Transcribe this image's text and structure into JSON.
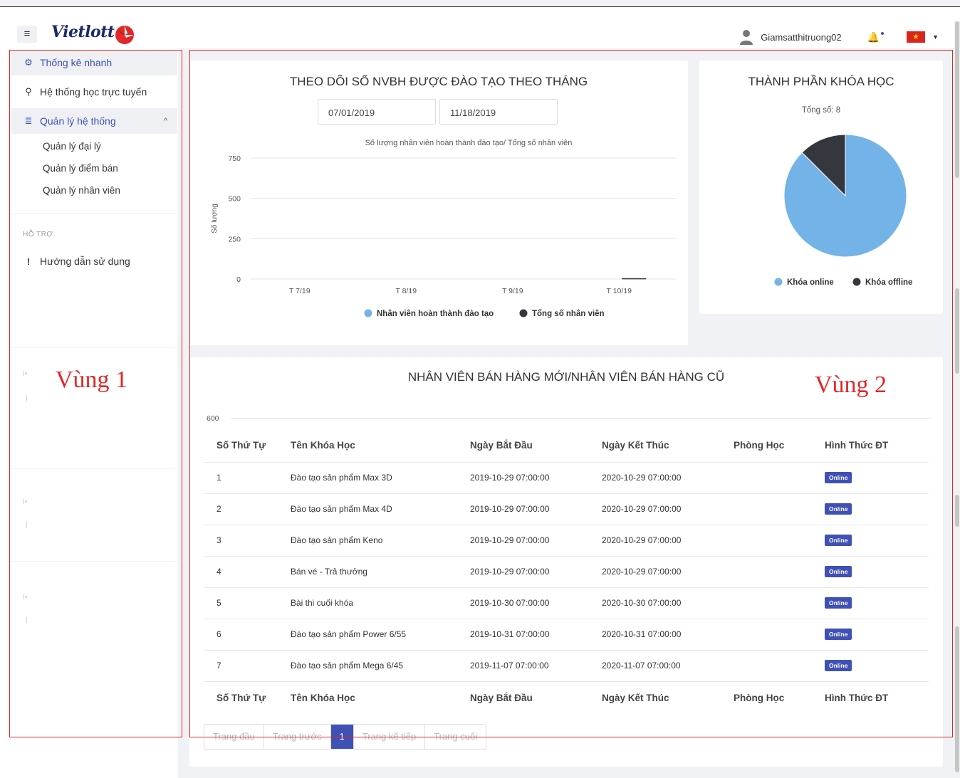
{
  "header": {
    "menu_icon": "hamburger-icon",
    "logo_text": "Vietlott",
    "username": "Giamsatthitruong02",
    "notification_icon": "bell-icon",
    "language_icon": "vietnam-flag-icon",
    "flag_star": "★",
    "menu_glyph": "≡",
    "caret": "▼"
  },
  "sidebar": {
    "items": [
      {
        "label": "Thống kê nhanh",
        "icon": "dashboard-icon",
        "glyph": "⚙"
      },
      {
        "label": "Hệ thống học trực tuyến",
        "icon": "graduation-cap-icon",
        "glyph": "🎓"
      },
      {
        "label": "Quản lý hệ thống",
        "icon": "database-icon",
        "glyph": "≣",
        "expand": "^"
      }
    ],
    "subitems": [
      "Quản lý đại lý",
      "Quản lý điểm bán",
      "Quản lý nhân viên"
    ],
    "section_caption": "HỖ TRỢ",
    "help_item": {
      "label": "Hướng dẫn sử dụng",
      "icon": "exclamation-icon",
      "glyph": "!"
    },
    "faint_mark": "I•",
    "faint_sub": "|"
  },
  "annotations": {
    "zone1": "Vùng 1",
    "zone2": "Vùng 2"
  },
  "training_card": {
    "title": "THEO DÕI SỐ NVBH ĐƯỢC ĐÀO TẠO THEO THÁNG",
    "date_from": "07/01/2019",
    "date_to": "11/18/2019"
  },
  "pie_card": {
    "title": "THÀNH PHẦN KHÓA HỌC",
    "total": "Tổng số: 8"
  },
  "chart_data": [
    {
      "type": "bar",
      "title": "Số lượng nhân viên hoàn thành đào tạo/ Tổng số nhân viên",
      "xlabel": "",
      "ylabel": "Số lượng",
      "categories": [
        "T 7/19",
        "T 8/19",
        "T 9/19",
        "T 10/19"
      ],
      "yticks": [
        "0",
        "250",
        "500",
        "750"
      ],
      "ylim": [
        0,
        750
      ],
      "series": [
        {
          "name": "Nhân viên hoàn thành đào tạo",
          "values": [
            0,
            0,
            0,
            0
          ],
          "color": "#74b3e8"
        },
        {
          "name": "Tổng số nhân viên",
          "values": [
            0,
            0,
            0,
            5
          ],
          "color": "#34373d"
        }
      ],
      "legend": "bottom"
    },
    {
      "type": "pie",
      "title": "",
      "labels": [
        "Khóa online",
        "Khóa offline"
      ],
      "values": [
        7,
        1
      ],
      "colors": [
        "#74b3e8",
        "#34373d"
      ],
      "legend": "bottom"
    }
  ],
  "table_card": {
    "title": "NHÂN VIÊN BÁN HÀNG MỚI/NHÂN VIÊN BÁN HÀNG CŨ",
    "axis_tick": "600",
    "columns": [
      "Số Thứ Tự",
      "Tên Khóa Học",
      "Ngày Bắt Đầu",
      "Ngày Kết Thúc",
      "Phòng Học",
      "Hình Thức ĐT"
    ],
    "rows": [
      {
        "stt": "1",
        "name": "Đào tạo sản phẩm Max 3D",
        "start": "2019-10-29 07:00:00",
        "end": "2020-10-29 07:00:00",
        "room": "",
        "type": "Online"
      },
      {
        "stt": "2",
        "name": "Đào tạo sản phẩm Max 4D",
        "start": "2019-10-29 07:00:00",
        "end": "2020-10-29 07:00:00",
        "room": "",
        "type": "Online"
      },
      {
        "stt": "3",
        "name": "Đào tạo sản phẩm Keno",
        "start": "2019-10-29 07:00:00",
        "end": "2020-10-29 07:00:00",
        "room": "",
        "type": "Online"
      },
      {
        "stt": "4",
        "name": "Bán vé - Trả thưởng",
        "start": "2019-10-29 07:00:00",
        "end": "2020-10-29 07:00:00",
        "room": "",
        "type": "Online"
      },
      {
        "stt": "5",
        "name": "Bài thi cuối khóa",
        "start": "2019-10-30 07:00:00",
        "end": "2020-10-30 07:00:00",
        "room": "",
        "type": "Online"
      },
      {
        "stt": "6",
        "name": "Đào tạo sản phẩm Power 6/55",
        "start": "2019-10-31 07:00:00",
        "end": "2020-10-31 07:00:00",
        "room": "",
        "type": "Online"
      },
      {
        "stt": "7",
        "name": "Đào tạo sản phẩm Mega 6/45",
        "start": "2019-11-07 07:00:00",
        "end": "2020-11-07 07:00:00",
        "room": "",
        "type": "Online"
      }
    ],
    "pager": [
      "Trang đầu",
      "Trang trước",
      "1",
      "Trang kế tiếp",
      "Trang cuối"
    ]
  }
}
